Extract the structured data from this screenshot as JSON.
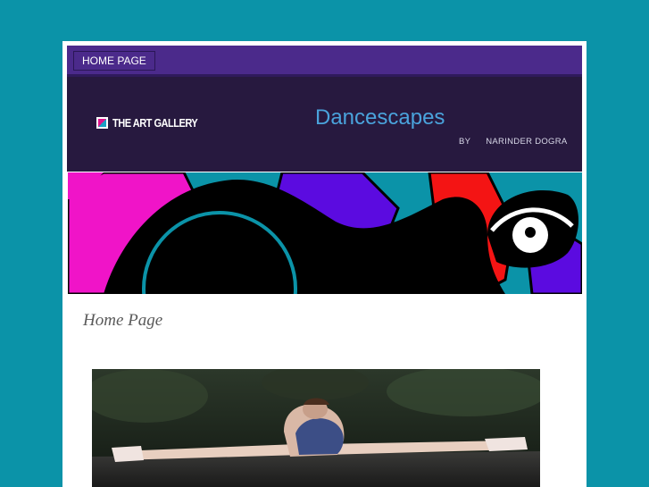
{
  "nav": {
    "items": [
      {
        "label": "HOME PAGE"
      }
    ]
  },
  "header": {
    "logo_text": "THE ART GALLERY",
    "site_title": "Dancescapes",
    "byline_prefix": "BY",
    "byline_author": "NARINDER DOGRA"
  },
  "main": {
    "page_heading": "Home Page"
  },
  "colors": {
    "background": "#0b93a8",
    "nav_bar": "#4b2a8b",
    "header_bg": "#27193f",
    "title_accent": "#4aa3dc"
  }
}
